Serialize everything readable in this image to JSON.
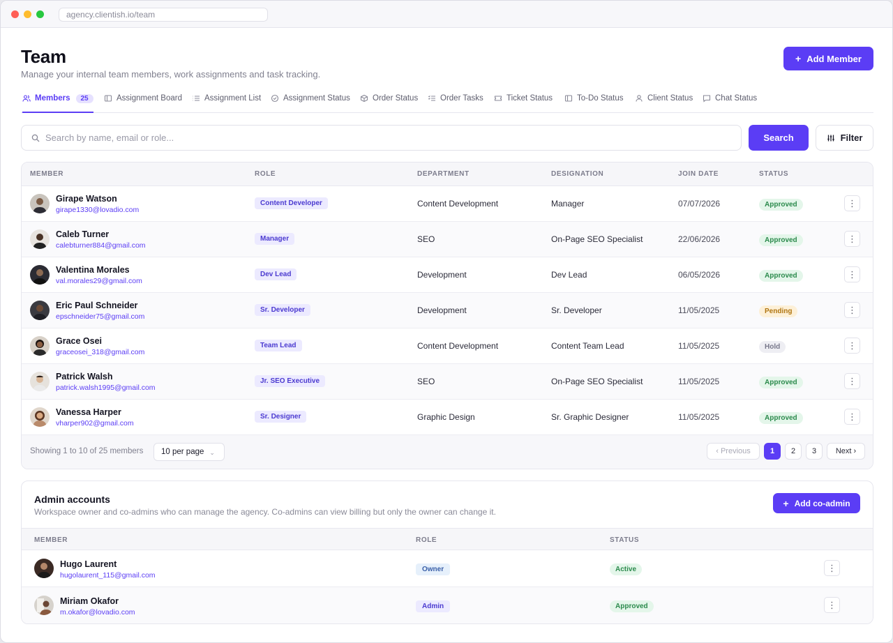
{
  "browser": {
    "url": "agency.clientish.io/team"
  },
  "header": {
    "title": "Team",
    "subtitle": "Manage your internal team members, work assignments and task tracking.",
    "add_member_label": "Add Member",
    "plus": "+"
  },
  "tabs": [
    {
      "label": "Members",
      "count": "25",
      "icon": "users-icon",
      "active": true
    },
    {
      "label": "Assignment Board",
      "icon": "board-icon"
    },
    {
      "label": "Assignment List",
      "icon": "list-icon"
    },
    {
      "label": "Assignment Status",
      "icon": "check-circle-icon"
    },
    {
      "label": "Order Status",
      "icon": "box-icon"
    },
    {
      "label": "Order Tasks",
      "icon": "checklist-icon"
    },
    {
      "label": "Ticket Status",
      "icon": "ticket-icon"
    },
    {
      "label": "To-Do Status",
      "icon": "todo-icon"
    },
    {
      "label": "Client Status",
      "icon": "user-icon"
    },
    {
      "label": "Chat Status",
      "icon": "chat-icon"
    }
  ],
  "search": {
    "placeholder": "Search by name, email or role...",
    "button_label": "Search",
    "filter_label": "Filter"
  },
  "members_table": {
    "headers": {
      "member": "MEMBER",
      "role": "ROLE",
      "department": "DEPARTMENT",
      "designation": "DESIGNATION",
      "join_date": "JOIN DATE",
      "status": "STATUS"
    },
    "rows": [
      {
        "name": "Girape Watson",
        "email": "girape1330@lovadio.com",
        "role": "Content Developer",
        "department": "Content Development",
        "designation": "Manager",
        "join_date": "07/07/2026",
        "status": "Approved",
        "status_type": "approved"
      },
      {
        "name": "Caleb Turner",
        "email": "calebturner884@gmail.com",
        "role": "Manager",
        "department": "SEO",
        "designation": "On-Page SEO Specialist",
        "join_date": "22/06/2026",
        "status": "Approved",
        "status_type": "approved"
      },
      {
        "name": "Valentina Morales",
        "email": "val.morales29@gmail.com",
        "role": "Dev Lead",
        "department": "Development",
        "designation": "Dev Lead",
        "join_date": "06/05/2026",
        "status": "Approved",
        "status_type": "approved"
      },
      {
        "name": "Eric Paul Schneider",
        "email": "epschneider75@gmail.com",
        "role": "Sr. Developer",
        "department": "Development",
        "designation": "Sr. Developer",
        "join_date": "11/05/2025",
        "status": "Pending",
        "status_type": "pending"
      },
      {
        "name": "Grace Osei",
        "email": "graceosei_318@gmail.com",
        "role": "Team Lead",
        "department": "Content Development",
        "designation": "Content Team Lead",
        "join_date": "11/05/2025",
        "status": "Hold",
        "status_type": "hold"
      },
      {
        "name": "Patrick Walsh",
        "email": "patrick.walsh1995@gmail.com",
        "role": "Jr. SEO Executive",
        "department": "SEO",
        "designation": "On-Page SEO Specialist",
        "join_date": "11/05/2025",
        "status": "Approved",
        "status_type": "approved"
      },
      {
        "name": "Vanessa Harper",
        "email": "vharper902@gmail.com",
        "role": "Sr. Designer",
        "department": "Graphic Design",
        "designation": "Sr. Graphic Designer",
        "join_date": "11/05/2025",
        "status": "Approved",
        "status_type": "approved"
      }
    ],
    "footer": {
      "showing": "Showing 1 to 10 of 25 members",
      "per_page": "10 per page",
      "prev": "‹ Previous",
      "pages": [
        "1",
        "2",
        "3"
      ],
      "next": "Next ›"
    }
  },
  "admin": {
    "title": "Admin accounts",
    "subtitle": "Workspace owner and co-admins who can manage the agency. Co-admins can view billing but only the owner can change it.",
    "add_label": "Add co-admin",
    "headers": {
      "member": "MEMBER",
      "role": "ROLE",
      "status": "STATUS"
    },
    "rows": [
      {
        "name": "Hugo Laurent",
        "email": "hugolaurent_115@gmail.com",
        "role": "Owner",
        "status": "Active"
      },
      {
        "name": "Miriam Okafor",
        "email": "m.okafor@lovadio.com",
        "role": "Admin",
        "status": "Approved"
      }
    ]
  },
  "colors": {
    "accent": "#5b3df5",
    "approved": "#2b8a4c",
    "pending": "#b17611",
    "hold": "#77778a"
  }
}
